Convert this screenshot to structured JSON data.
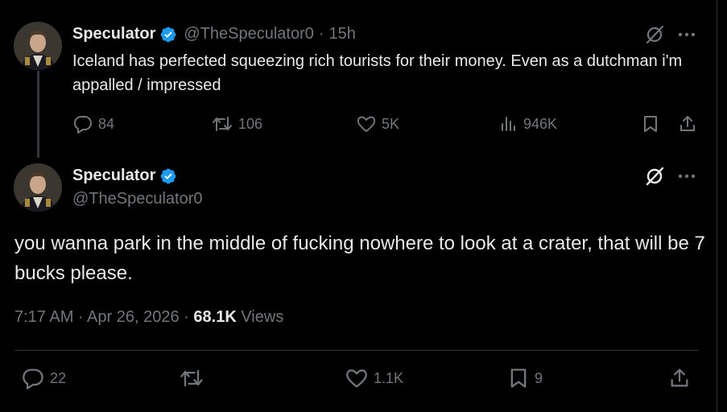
{
  "parent_tweet": {
    "author_name": "Speculator",
    "handle": "@TheSpeculator0",
    "separator": "·",
    "time_ago": "15h",
    "text": "Iceland has perfected squeezing rich tourists for their money. Even as a dutchman i'm appalled / impressed",
    "actions": {
      "replies": "84",
      "reposts": "106",
      "likes": "5K",
      "views": "946K"
    }
  },
  "main_tweet": {
    "author_name": "Speculator",
    "handle": "@TheSpeculator0",
    "text": "you wanna park in the middle of fucking nowhere to look at a crater, that will be 7 bucks please.",
    "timestamp": "7:17 AM · Apr 26, 2026",
    "meta_separator": "·",
    "views_count": "68.1K",
    "views_label": "Views",
    "actions": {
      "replies": "22",
      "likes": "1.1K",
      "bookmarks": "9"
    }
  },
  "colors": {
    "background": "#000000",
    "text_primary": "#e7e9ea",
    "text_secondary": "#71767b",
    "verified_blue": "#1d9bf0",
    "divider": "#2f3336"
  },
  "icons": [
    "verified-badge-icon",
    "grok-icon",
    "more-icon",
    "reply-icon",
    "repost-icon",
    "like-icon",
    "views-icon",
    "bookmark-icon",
    "share-icon"
  ]
}
